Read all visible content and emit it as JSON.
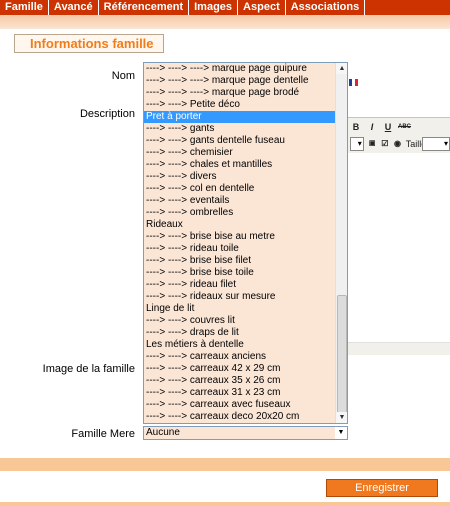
{
  "tabs": [
    "Famille",
    "Avancé",
    "Référencement",
    "Images",
    "Aspect",
    "Associations"
  ],
  "section_title": "Informations famille",
  "labels": {
    "nom": "Nom",
    "description": "Description",
    "image": "Image de la famille",
    "mere": "Famille Mere"
  },
  "editor": {
    "bold": "B",
    "italic": "I",
    "underline": "U",
    "strike": "ABC",
    "taille": "Taille"
  },
  "dropdown": {
    "selected_index": 4,
    "items": [
      "----> ----> ----> marque page guipure",
      "----> ----> ----> marque page dentelle",
      "----> ----> ----> marque page brodé",
      "----> ----> Petite déco",
      "Pret à porter",
      "----> ----> gants",
      "----> ----> gants dentelle fuseau",
      "----> ----> chemisier",
      "----> ----> chales et mantilles",
      "----> ----> divers",
      "----> ----> col en dentelle",
      "----> ----> eventails",
      "----> ----> ombrelles",
      "Rideaux",
      "----> ----> brise bise au metre",
      "----> ----> rideau toile",
      "----> ----> brise bise filet",
      "----> ----> brise bise toile",
      "----> ----> rideau filet",
      "----> ----> rideaux sur mesure",
      "Linge de lit",
      "----> ----> couvres lit",
      "----> ----> draps de lit",
      "Les métiers à dentelle",
      "----> ----> carreaux anciens",
      "----> ----> carreaux 42 x 29 cm",
      "----> ----> carreaux 35 x 26 cm",
      "----> ----> carreaux 31 x 23 cm",
      "----> ----> carreaux avec fuseaux",
      "----> ----> carreaux deco 20x20 cm"
    ]
  },
  "famille_mere_value": "Aucune",
  "save_label": "Enregistrer"
}
